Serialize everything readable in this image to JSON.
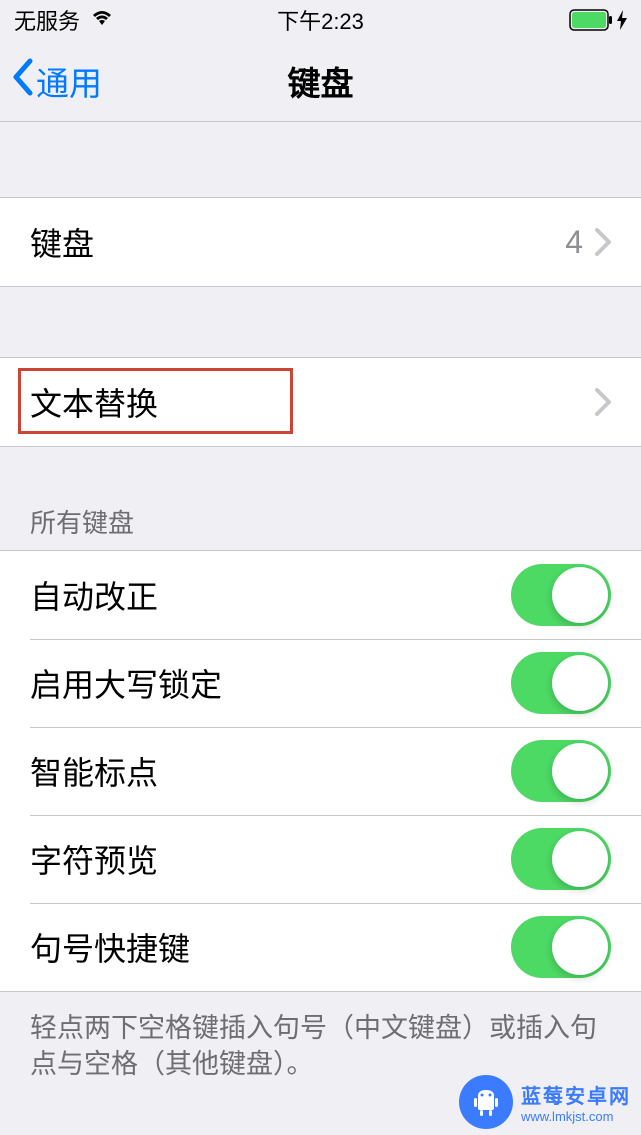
{
  "status": {
    "carrier": "无服务",
    "time": "下午2:23"
  },
  "nav": {
    "back": "通用",
    "title": "键盘"
  },
  "keyboards_row": {
    "label": "键盘",
    "value": "4"
  },
  "text_replace": {
    "label": "文本替换"
  },
  "section": {
    "all_keyboards": "所有键盘"
  },
  "toggles": [
    {
      "label": "自动改正",
      "on": true
    },
    {
      "label": "启用大写锁定",
      "on": true
    },
    {
      "label": "智能标点",
      "on": true
    },
    {
      "label": "字符预览",
      "on": true
    },
    {
      "label": "句号快捷键",
      "on": true
    }
  ],
  "footer": "轻点两下空格键插入句号（中文键盘）或插入句点与空格（其他键盘）。",
  "watermark": {
    "title": "蓝莓安卓网",
    "url": "www.lmkjst.com"
  }
}
